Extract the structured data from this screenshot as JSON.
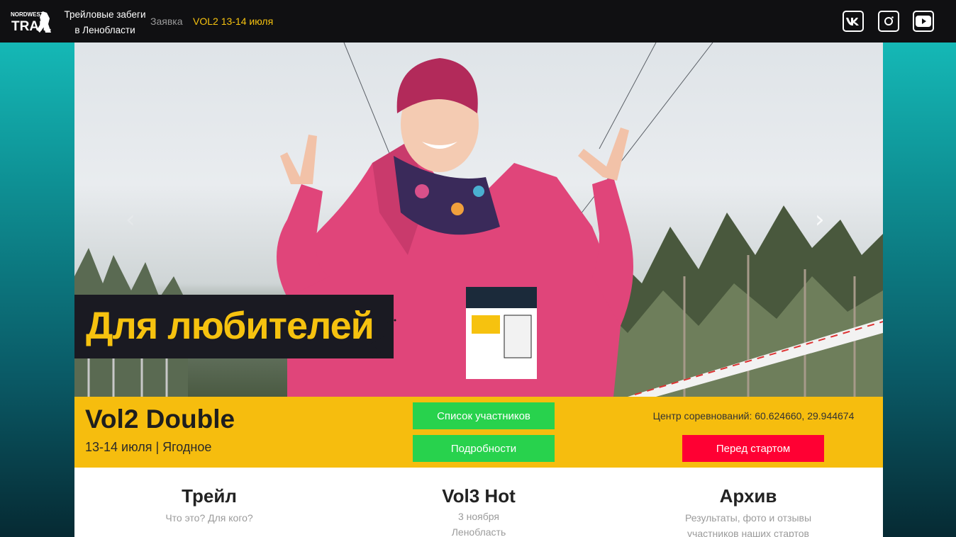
{
  "nav": {
    "logo_text_top": "NORDWEST",
    "logo_text_bottom": "TRAIL",
    "brand_line1": "Трейловые забеги",
    "brand_line2": "в Ленобласти",
    "apply_link": "Заявка",
    "vol2_link": "VOL2 13-14 июля",
    "social": [
      "vk-icon",
      "instagram-icon",
      "youtube-icon"
    ]
  },
  "hero": {
    "slogan": "Для любителей"
  },
  "event": {
    "title": "Vol2 Double",
    "subtitle": "13-14 июля | Ягодное",
    "participants_button": "Список участников",
    "details_button": "Подробности",
    "coords": "Центр соревнований: 60.624660, 29.944674",
    "prestart_button": "Перед стартом"
  },
  "sections": [
    {
      "title": "Трейл",
      "text": "Что это? Для кого?"
    },
    {
      "title": "Vol3 Hot",
      "text_line1": "3 ноября",
      "text_line2": "Ленобласть"
    },
    {
      "title": "Архив",
      "text_line1": "Результаты, фото и отзывы",
      "text_line2": "участников наших стартов"
    }
  ],
  "colors": {
    "nav_bg": "#101012",
    "accent_yellow": "#f6c20f",
    "event_bar": "#f6bd0e",
    "green_button": "#28d24d",
    "red_button": "#ff0033"
  }
}
